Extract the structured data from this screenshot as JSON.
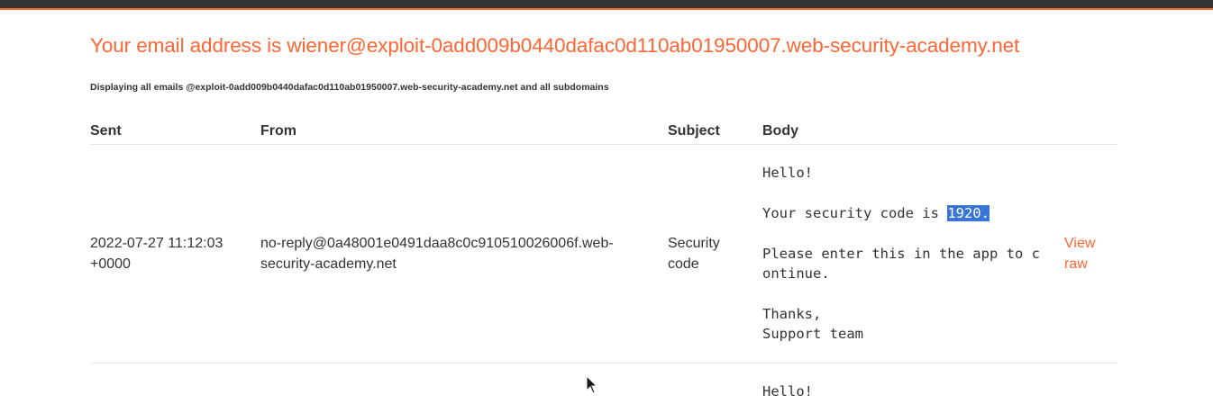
{
  "page": {
    "heading": "Your email address is wiener@exploit-0add009b0440dafac0d110ab01950007.web-security-academy.net",
    "subheading": "Displaying all emails @exploit-0add009b0440dafac0d110ab01950007.web-security-academy.net and all subdomains"
  },
  "table": {
    "columns": [
      "Sent",
      "From",
      "Subject",
      "Body"
    ],
    "rows": [
      {
        "sent_line1": "2022-07-27 11:12:03",
        "sent_line2": "+0000",
        "from_line1": "no-reply@0a48001e0491daa8c0c910510026006f.web-",
        "from_line2": "security-academy.net",
        "subject_line1": "Security",
        "subject_line2": "code",
        "body": {
          "line1": "Hello!",
          "line2_prefix": "Your security code is ",
          "line2_selected": "1920.",
          "line3": "Please enter this in the app to c",
          "line4": "ontinue.",
          "line5": "Thanks,",
          "line6": "Support team"
        },
        "action_line1": "View",
        "action_line2": "raw"
      },
      {
        "body": {
          "line1": "Hello!"
        }
      }
    ]
  },
  "colors": {
    "accent": "#ff6633",
    "topbar": "#333332",
    "text": "#333332",
    "selection": "#3875d7"
  }
}
